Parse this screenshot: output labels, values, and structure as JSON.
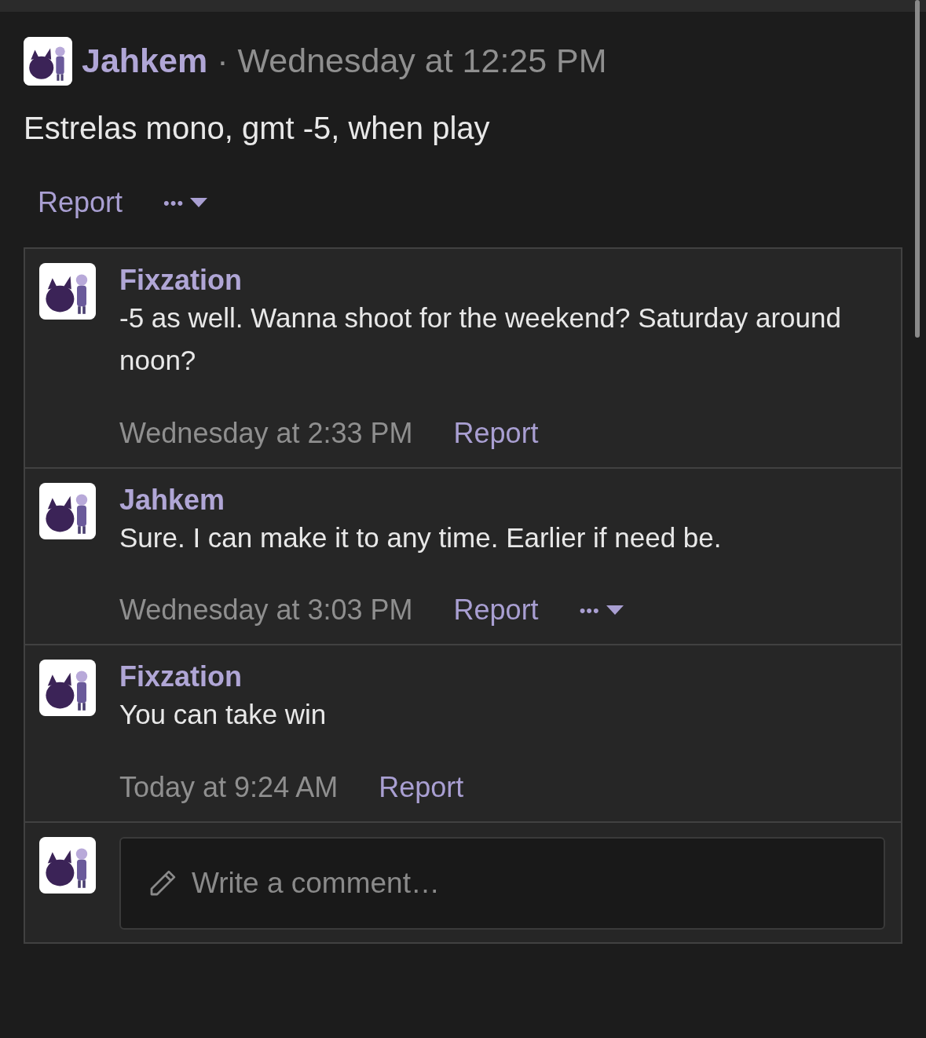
{
  "post": {
    "author": "Jahkem",
    "separator": "·",
    "time": "Wednesday at 12:25 PM",
    "text": "Estrelas mono, gmt -5, when play",
    "actions": {
      "report": "Report",
      "more": "•••"
    }
  },
  "comments": [
    {
      "author": "Fixzation",
      "text": "-5 as well. Wanna shoot for the weekend? Saturday around noon?",
      "time": "Wednesday at 2:33 PM",
      "report": "Report"
    },
    {
      "author": "Jahkem",
      "text": "Sure. I can make it to any time. Earlier if need be.",
      "time": "Wednesday at 3:03 PM",
      "report": "Report",
      "more": "•••"
    },
    {
      "author": "Fixzation",
      "text": "You can take win",
      "time": "Today at 9:24 AM",
      "report": "Report"
    }
  ],
  "reply": {
    "placeholder": "Write a comment…"
  }
}
